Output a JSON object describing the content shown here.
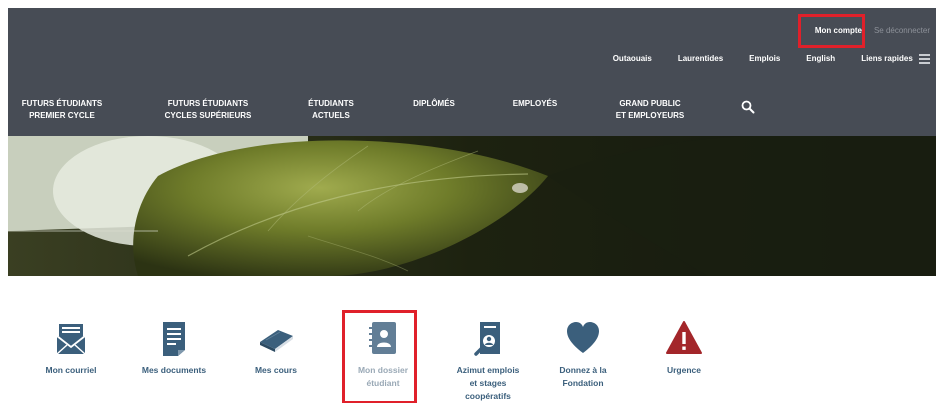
{
  "account": {
    "login_label": "Mon compte",
    "logout_label": "Se déconnecter"
  },
  "utility_nav": [
    "Outaouais",
    "Laurentides",
    "Emplois",
    "English",
    "Liens rapides"
  ],
  "main_nav": [
    {
      "line1": "FUTURS ÉTUDIANTS",
      "line2": "PREMIER CYCLE"
    },
    {
      "line1": "FUTURS ÉTUDIANTS",
      "line2": "CYCLES SUPÉRIEURS"
    },
    {
      "line1": "ÉTUDIANTS",
      "line2": "ACTUELS"
    },
    {
      "line1": "DIPLÔMÉS",
      "line2": ""
    },
    {
      "line1": "EMPLOYÉS",
      "line2": ""
    },
    {
      "line1": "GRAND PUBLIC",
      "line2": "ET EMPLOYEURS"
    }
  ],
  "tiles": [
    {
      "line1": "Mon courriel",
      "line2": "",
      "line3": ""
    },
    {
      "line1": "Mes documents",
      "line2": "",
      "line3": ""
    },
    {
      "line1": "Mes cours",
      "line2": "",
      "line3": ""
    },
    {
      "line1": "Mon dossier",
      "line2": "étudiant",
      "line3": ""
    },
    {
      "line1": "Azimut emplois",
      "line2": "et stages",
      "line3": "coopératifs"
    },
    {
      "line1": "Donnez à la",
      "line2": "Fondation",
      "line3": ""
    },
    {
      "line1": "Urgence",
      "line2": "",
      "line3": ""
    }
  ],
  "colors": {
    "header": "#474c55",
    "icon": "#3b5f7c",
    "urgent": "#a3262a",
    "highlight": "#e0202a"
  },
  "icons": {
    "mail": "envelope-icon",
    "documents": "document-icon",
    "courses": "book-icon",
    "record": "contact-book-icon",
    "jobs": "search-document-icon",
    "donate": "heart-icon",
    "urgent": "warning-icon",
    "search": "search-icon",
    "menu": "hamburger-icon"
  }
}
